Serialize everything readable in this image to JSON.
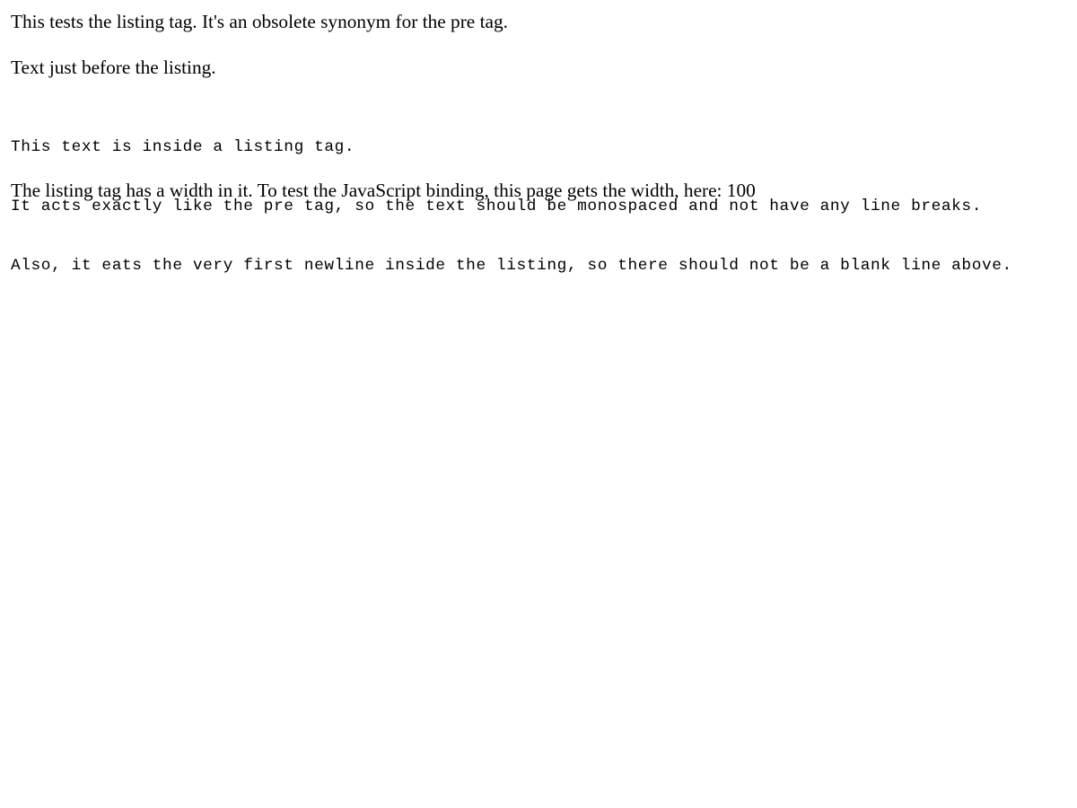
{
  "intro": {
    "text": "This tests the listing tag. It's an obsolete synonym for the pre tag."
  },
  "before_listing": {
    "text": "Text just before the listing."
  },
  "listing": {
    "lines": [
      "This text is inside a listing tag.",
      "It acts exactly like the pre tag, so the text should be monospaced and not have any line breaks.",
      "Also, it eats the very first newline inside the listing, so there should not be a blank line above."
    ]
  },
  "width_note": {
    "text": "The listing tag has a width in it. To test the JavaScript binding, this page gets the width, here: 100"
  }
}
